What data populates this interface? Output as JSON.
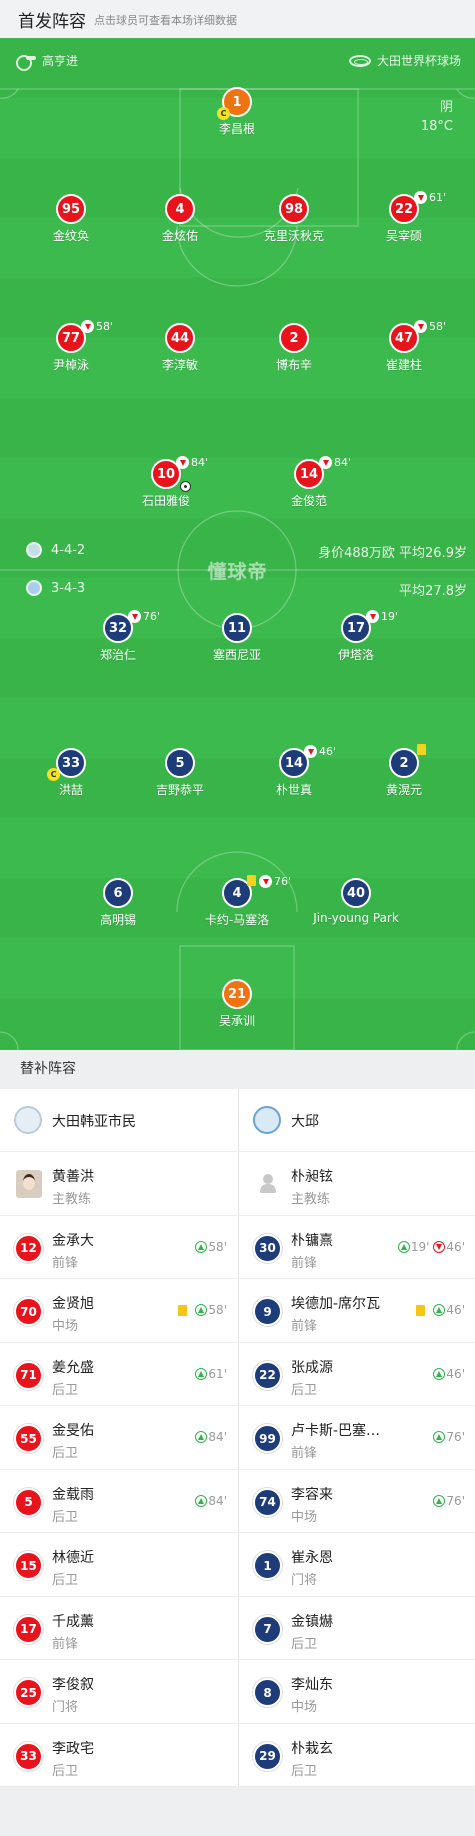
{
  "header": {
    "title": "首发阵容",
    "subtitle": "点击球员可查看本场详细数据"
  },
  "match": {
    "coach_home": "高亨进",
    "stadium": "大田世界杯球场",
    "weather": "阴",
    "temperature": "18°C",
    "watermark": "懂球帝"
  },
  "home": {
    "formation": "4-4-2",
    "value_line": "身价488万欧   平均26.9岁",
    "players": [
      {
        "num": "1",
        "name": "李昌根",
        "captain": "C"
      },
      {
        "num": "95",
        "name": "金纹奂"
      },
      {
        "num": "4",
        "name": "金炫佑"
      },
      {
        "num": "98",
        "name": "克里沃秋克"
      },
      {
        "num": "22",
        "name": "吴宰硕",
        "sub": "61'"
      },
      {
        "num": "77",
        "name": "尹棹泳",
        "sub": "58'"
      },
      {
        "num": "44",
        "name": "李淳敏"
      },
      {
        "num": "2",
        "name": "博布辛"
      },
      {
        "num": "47",
        "name": "崔建柱",
        "sub": "58'"
      },
      {
        "num": "10",
        "name": "石田雅俊",
        "sub": "84'"
      },
      {
        "num": "14",
        "name": "金俊范",
        "sub": "84'"
      }
    ]
  },
  "away": {
    "formation": "3-4-3",
    "value_line": "平均27.8岁",
    "players": [
      {
        "num": "32",
        "name": "郑治仁",
        "sub": "76'"
      },
      {
        "num": "11",
        "name": "塞西尼亚"
      },
      {
        "num": "17",
        "name": "伊塔洛",
        "sub": "19'"
      },
      {
        "num": "33",
        "name": "洪喆",
        "captain": "C"
      },
      {
        "num": "5",
        "name": "吉野恭平"
      },
      {
        "num": "14",
        "name": "朴世真",
        "sub": "46'"
      },
      {
        "num": "2",
        "name": "黄滉元"
      },
      {
        "num": "6",
        "name": "高明锡"
      },
      {
        "num": "4",
        "name": "卡约-马塞洛",
        "sub": "76'"
      },
      {
        "num": "40",
        "name": "Jin-young Park"
      },
      {
        "num": "21",
        "name": "吴承训"
      }
    ]
  },
  "subs": {
    "title": "替补阵容",
    "home": {
      "team": "大田韩亚市民",
      "coach": {
        "name": "黄善洪",
        "role": "主教练"
      },
      "players": [
        {
          "num": "12",
          "name": "金承大",
          "pos": "前锋",
          "in": "58'"
        },
        {
          "num": "70",
          "name": "金贤旭",
          "pos": "中场",
          "in": "58'",
          "yellow": true
        },
        {
          "num": "71",
          "name": "姜允盛",
          "pos": "后卫",
          "in": "61'"
        },
        {
          "num": "55",
          "name": "金旻佑",
          "pos": "后卫",
          "in": "84'"
        },
        {
          "num": "5",
          "name": "金载雨",
          "pos": "后卫",
          "in": "84'"
        },
        {
          "num": "15",
          "name": "林德近",
          "pos": "后卫"
        },
        {
          "num": "17",
          "name": "千成薰",
          "pos": "前锋"
        },
        {
          "num": "25",
          "name": "李俊叙",
          "pos": "门将"
        },
        {
          "num": "33",
          "name": "李政宅",
          "pos": "后卫"
        }
      ]
    },
    "away": {
      "team": "大邱",
      "coach": {
        "name": "朴昶铉",
        "role": "主教练"
      },
      "players": [
        {
          "num": "30",
          "name": "朴镛熹",
          "pos": "前锋",
          "in": "19'",
          "out": "46'"
        },
        {
          "num": "9",
          "name": "埃德加-席尔瓦",
          "pos": "前锋",
          "in": "46'",
          "yellow": true
        },
        {
          "num": "22",
          "name": "张成源",
          "pos": "后卫",
          "in": "46'"
        },
        {
          "num": "99",
          "name": "卢卡斯-巴塞…",
          "pos": "前锋",
          "in": "76'"
        },
        {
          "num": "74",
          "name": "李容来",
          "pos": "中场",
          "in": "76'"
        },
        {
          "num": "1",
          "name": "崔永恩",
          "pos": "门将"
        },
        {
          "num": "7",
          "name": "金镇爀",
          "pos": "后卫"
        },
        {
          "num": "8",
          "name": "李灿东",
          "pos": "中场"
        },
        {
          "num": "29",
          "name": "朴栽玄",
          "pos": "后卫"
        }
      ]
    }
  },
  "colors": {
    "home": "#e8131b",
    "home_keeper": "#f07312",
    "away": "#1d3c79",
    "pitch": "#39b449"
  }
}
